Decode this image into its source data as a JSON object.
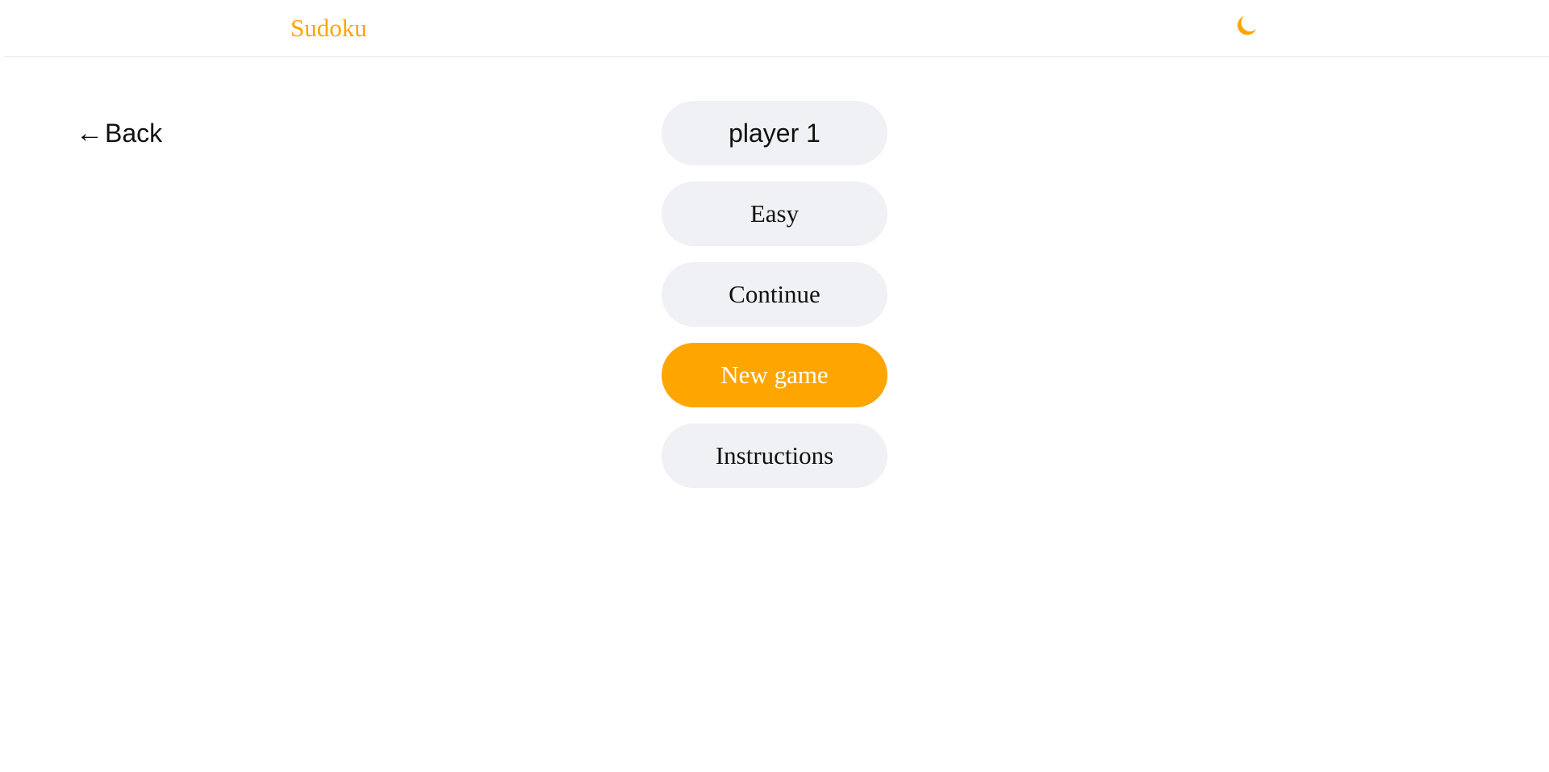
{
  "header": {
    "brand": "Sudoku",
    "theme_toggle_icon": "moon-icon"
  },
  "nav": {
    "back_arrow": "←",
    "back_label": "Back"
  },
  "menu": {
    "player_name_value": "player 1",
    "difficulty_label": "Easy",
    "continue_label": "Continue",
    "new_game_label": "New game",
    "instructions_label": "Instructions"
  },
  "colors": {
    "accent": "#ffa500",
    "pill_background": "#f0f1f4",
    "text": "#111111",
    "header_border": "#e5e7eb"
  }
}
